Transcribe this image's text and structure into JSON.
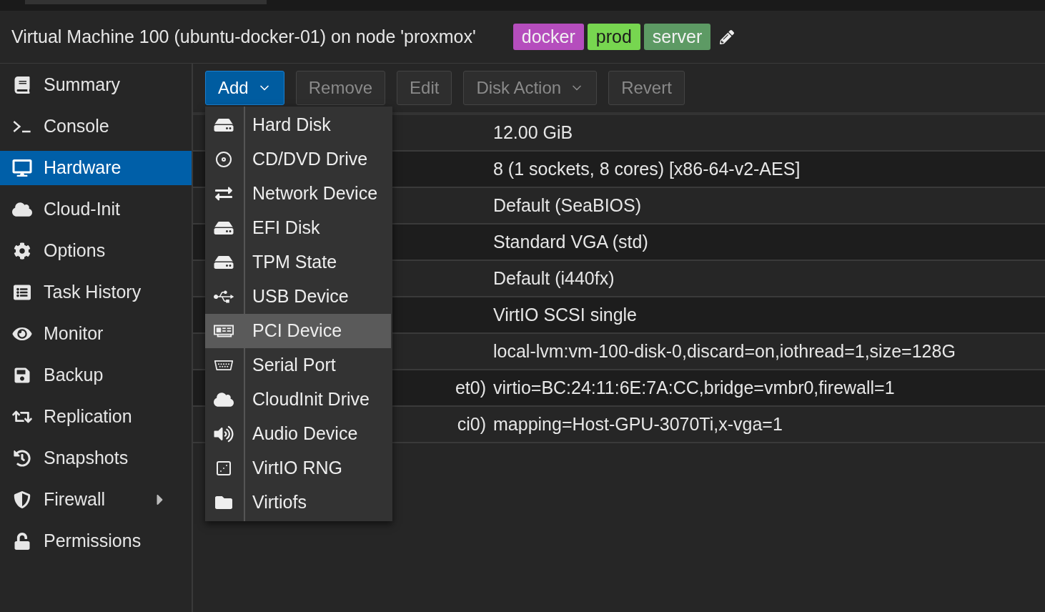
{
  "header": {
    "title": "Virtual Machine 100 (ubuntu-docker-01) on node 'proxmox'",
    "tags": [
      {
        "label": "docker",
        "color": "#b54dbd"
      },
      {
        "label": "prod",
        "color": "#77d650"
      },
      {
        "label": "server",
        "color": "#5d9a64"
      }
    ]
  },
  "sidebar": {
    "items": [
      {
        "label": "Summary",
        "selected": false,
        "submenu": false
      },
      {
        "label": "Console",
        "selected": false,
        "submenu": false
      },
      {
        "label": "Hardware",
        "selected": true,
        "submenu": false
      },
      {
        "label": "Cloud-Init",
        "selected": false,
        "submenu": false
      },
      {
        "label": "Options",
        "selected": false,
        "submenu": false
      },
      {
        "label": "Task History",
        "selected": false,
        "submenu": false
      },
      {
        "label": "Monitor",
        "selected": false,
        "submenu": false
      },
      {
        "label": "Backup",
        "selected": false,
        "submenu": false
      },
      {
        "label": "Replication",
        "selected": false,
        "submenu": false
      },
      {
        "label": "Snapshots",
        "selected": false,
        "submenu": false
      },
      {
        "label": "Firewall",
        "selected": false,
        "submenu": true
      },
      {
        "label": "Permissions",
        "selected": false,
        "submenu": false
      }
    ]
  },
  "toolbar": {
    "buttons": [
      {
        "label": "Add",
        "disabled": false,
        "dropdown": true
      },
      {
        "label": "Remove",
        "disabled": true,
        "dropdown": false
      },
      {
        "label": "Edit",
        "disabled": true,
        "dropdown": false
      },
      {
        "label": "Disk Action",
        "disabled": true,
        "dropdown": true
      },
      {
        "label": "Revert",
        "disabled": true,
        "dropdown": false
      }
    ]
  },
  "add_menu": {
    "items": [
      {
        "label": "Hard Disk",
        "selected": false
      },
      {
        "label": "CD/DVD Drive",
        "selected": false
      },
      {
        "label": "Network Device",
        "selected": false
      },
      {
        "label": "EFI Disk",
        "selected": false
      },
      {
        "label": "TPM State",
        "selected": false
      },
      {
        "label": "USB Device",
        "selected": false
      },
      {
        "label": "PCI Device",
        "selected": true
      },
      {
        "label": "Serial Port",
        "selected": false
      },
      {
        "label": "CloudInit Drive",
        "selected": false
      },
      {
        "label": "Audio Device",
        "selected": false
      },
      {
        "label": "VirtIO RNG",
        "selected": false
      },
      {
        "label": "Virtiofs",
        "selected": false
      }
    ]
  },
  "table": {
    "rows": [
      {
        "value": "12.00 GiB"
      },
      {
        "value": "8 (1 sockets, 8 cores) [x86-64-v2-AES]"
      },
      {
        "value": "Default (SeaBIOS)"
      },
      {
        "value": "Standard VGA (std)"
      },
      {
        "value": "Default (i440fx)"
      },
      {
        "value": "VirtIO SCSI single"
      },
      {
        "value": "local-lvm:vm-100-disk-0,discard=on,iothread=1,size=128G"
      },
      {
        "column_1": "et0)",
        "value": "virtio=BC:24:11:6E:7A:CC,bridge=vmbr0,firewall=1"
      },
      {
        "column_1": "ci0)",
        "value": "mapping=Host-GPU-3070Ti,x-vga=1"
      }
    ]
  }
}
